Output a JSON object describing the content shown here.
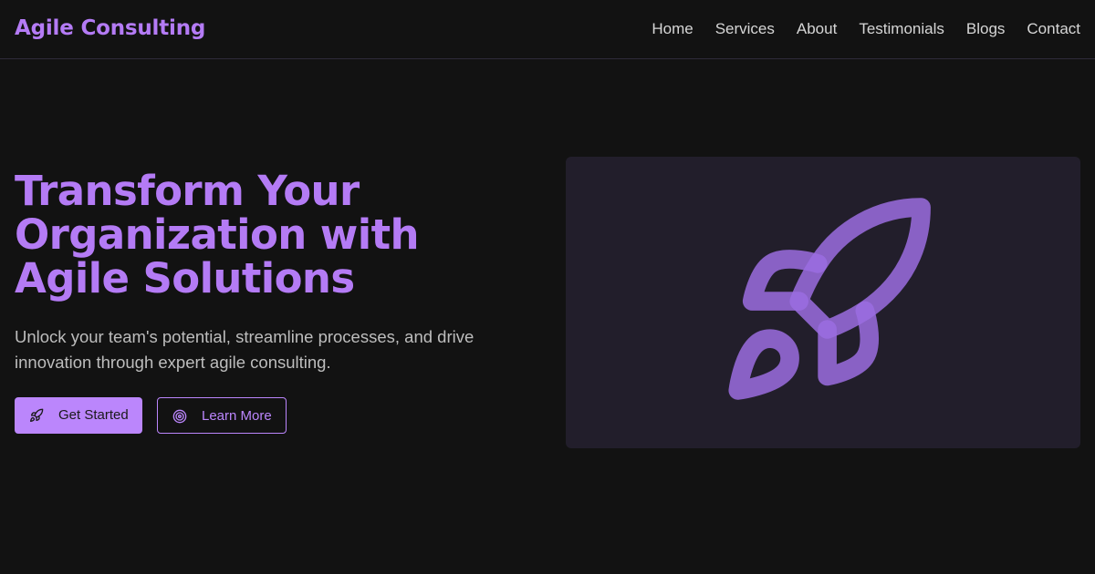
{
  "header": {
    "brand": "Agile Consulting",
    "nav": [
      "Home",
      "Services",
      "About",
      "Testimonials",
      "Blogs",
      "Contact"
    ]
  },
  "hero": {
    "title_lines": [
      "Transform Your",
      "Organization with",
      "Agile Solutions"
    ],
    "subtitle": "Unlock your team's potential, streamline processes, and drive innovation through expert agile consulting.",
    "primary_button": {
      "label": "Get Started",
      "icon": "rocket-icon"
    },
    "secondary_button": {
      "label": "Learn More",
      "icon": "target-icon"
    },
    "illustration_icon": "rocket-icon"
  },
  "colors": {
    "background": "#121212",
    "accent": "#bb86fc",
    "brand_text": "#b47bf5",
    "panel": "#221e2b",
    "nav_text": "#d6d6d6",
    "body_text": "#bdbdbd"
  }
}
